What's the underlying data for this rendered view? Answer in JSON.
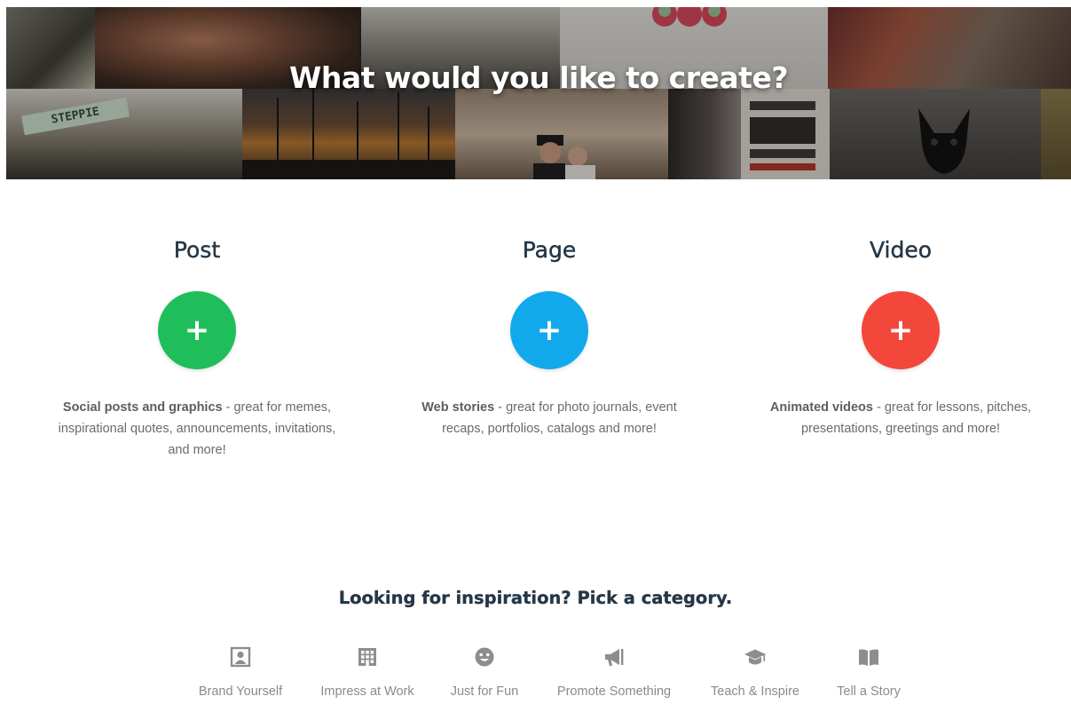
{
  "hero": {
    "title": "What would you like to create?",
    "sign_text": "STEPPIE"
  },
  "options": [
    {
      "title": "Post",
      "button": "+",
      "color": "#1fbe5a",
      "desc_bold": "Social posts and graphics",
      "desc_rest": " - great for memes, inspirational quotes, announcements, invitations, and more!"
    },
    {
      "title": "Page",
      "button": "+",
      "color": "#12a9ec",
      "desc_bold": "Web stories",
      "desc_rest": " - great for photo journals, event recaps, portfolios, catalogs and more!"
    },
    {
      "title": "Video",
      "button": "+",
      "color": "#f2473a",
      "desc_bold": "Animated videos",
      "desc_rest": " - great for lessons, pitches, presentations, greetings and more!"
    }
  ],
  "inspiration": {
    "title": "Looking for inspiration? Pick a category.",
    "categories": [
      {
        "label": "Brand Yourself",
        "icon": "portrait-icon"
      },
      {
        "label": "Impress at Work",
        "icon": "building-icon"
      },
      {
        "label": "Just for Fun",
        "icon": "smiley-icon"
      },
      {
        "label": "Promote Something",
        "icon": "megaphone-icon"
      },
      {
        "label": "Teach & Inspire",
        "icon": "graduation-cap-icon"
      },
      {
        "label": "Tell a Story",
        "icon": "book-icon"
      }
    ]
  },
  "colors": {
    "heading": "#253746",
    "body_text": "#6b6b6b",
    "category_text": "#8a8a8a",
    "category_icon": "#8d8d8d"
  }
}
